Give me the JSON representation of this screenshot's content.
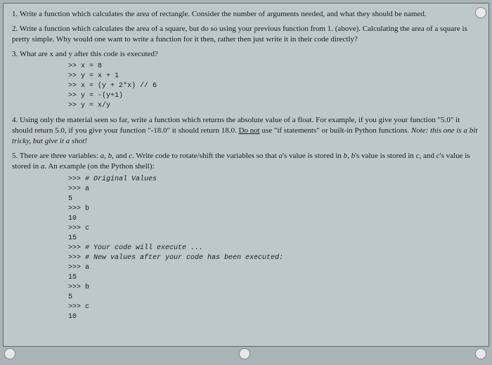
{
  "questions": {
    "q1": {
      "num": "1.",
      "text": "Write a function which calculates the area of rectangle. Consider the number of arguments needed, and what they should be named."
    },
    "q2": {
      "num": "2.",
      "text": "Write a function which calculates the area of a square, but do so using your previous function from 1. (above). Calculating the area of a square is pretty simple. Why would one want to write a function for it then, rather then just write it in their code directly?"
    },
    "q3": {
      "num": "3.",
      "text": "What are x and y after this code is executed?",
      "code": [
        ">> x = 8",
        ">> y = x + 1",
        ">> x = (y + 2*x) // 6",
        ">> y = -(y+1)",
        ">> y = x/y"
      ]
    },
    "q4": {
      "num": "4.",
      "text_part1": "Using only the material seen so far, write a function which returns the absolute value of a float. For example, if you give your function \"5.0\" it should return 5.0, if you give your function \"-18.0\" it should return 18.0. ",
      "underlined": "Do not",
      "text_part2": " use \"if statements\" or built-in Python functions. ",
      "note": "Note: this one is a bit tricky, but give it a shot!"
    },
    "q5": {
      "num": "5.",
      "text_part1": "There are three variables: ",
      "vars": "a, b,",
      "text_mid": " and ",
      "varc": "c.",
      "text_part2": " Write code to rotate/shift the variables so that ",
      "va": "a",
      "text_p3": "'s value is stored in ",
      "vb": "b, b",
      "text_p4": "'s value is stored in ",
      "vc": "c,",
      "text_p5": " and ",
      "vc2": "c",
      "text_p6": "'s value is stored in ",
      "va2": "a.",
      "text_p7": " An example (on the Python shell):",
      "code": [
        ">>> # Original Values",
        ">>> a",
        "5",
        ">>> b",
        "10",
        ">>> c",
        "15",
        ">>> # Your code will execute ...",
        ">>> # New values after your code has been executed:",
        ">>> a",
        "15",
        ">>> b",
        "5",
        ">>> c",
        "10"
      ]
    }
  }
}
